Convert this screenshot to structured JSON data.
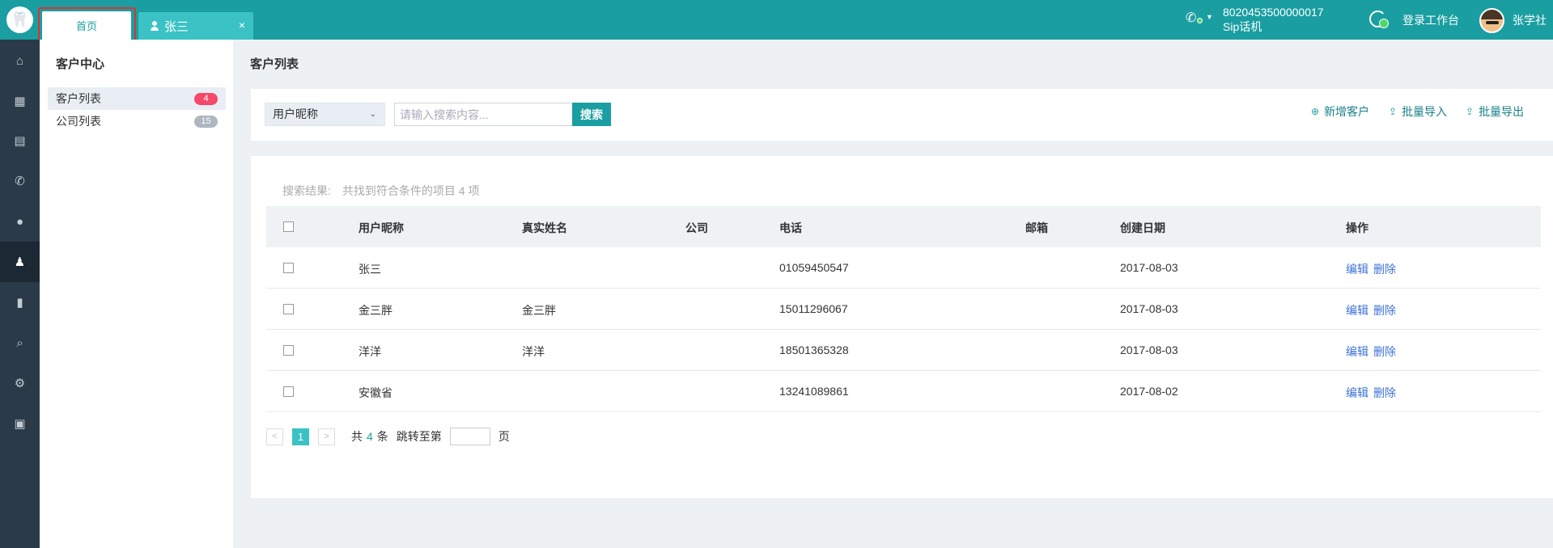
{
  "tabs": {
    "home": "首页",
    "user": "张三",
    "close": "×"
  },
  "header": {
    "logo": "🦷",
    "sip_number": "8020453500000017",
    "sip_label": "Sip话机",
    "workspace_label": "登录工作台",
    "user_name": "张学社"
  },
  "sidebar": {
    "title": "客户中心",
    "items": [
      {
        "label": "客户列表",
        "count": "4"
      },
      {
        "label": "公司列表",
        "count": "15"
      }
    ]
  },
  "icons": [
    "home-icon",
    "apps-icon",
    "book-icon",
    "phone-icon",
    "user-icon",
    "customers-icon",
    "chart-icon",
    "search-icon",
    "gear-icon",
    "report-icon"
  ],
  "main": {
    "title": "客户列表",
    "search": {
      "field": "用户昵称",
      "placeholder": "请输入搜索内容...",
      "button": "搜索"
    },
    "actions": {
      "add": "新增客户",
      "import": "批量导入",
      "export": "批量导出"
    },
    "result_label": "搜索结果:",
    "result_text": "共找到符合条件的项目 4 项",
    "columns": [
      "用户昵称",
      "真实姓名",
      "公司",
      "电话",
      "邮箱",
      "创建日期",
      "操作"
    ],
    "rows": [
      {
        "nickname": "张三",
        "realname": "",
        "company": "",
        "phone": "01059450547",
        "email": "",
        "date": "2017-08-03"
      },
      {
        "nickname": "金三胖",
        "realname": "金三胖",
        "company": "",
        "phone": "15011296067",
        "email": "",
        "date": "2017-08-03"
      },
      {
        "nickname": "洋洋",
        "realname": "洋洋",
        "company": "",
        "phone": "18501365328",
        "email": "",
        "date": "2017-08-03"
      },
      {
        "nickname": "安徽省",
        "realname": "",
        "company": "",
        "phone": "13241089861",
        "email": "",
        "date": "2017-08-02"
      }
    ],
    "ops": {
      "edit": "编辑",
      "delete": "删除"
    },
    "pager": {
      "prev": "<",
      "current": "1",
      "next": ">",
      "total_prefix": "共",
      "total": "4",
      "total_suffix": "条",
      "jump_label": "跳转至第",
      "page_suffix": "页"
    }
  }
}
